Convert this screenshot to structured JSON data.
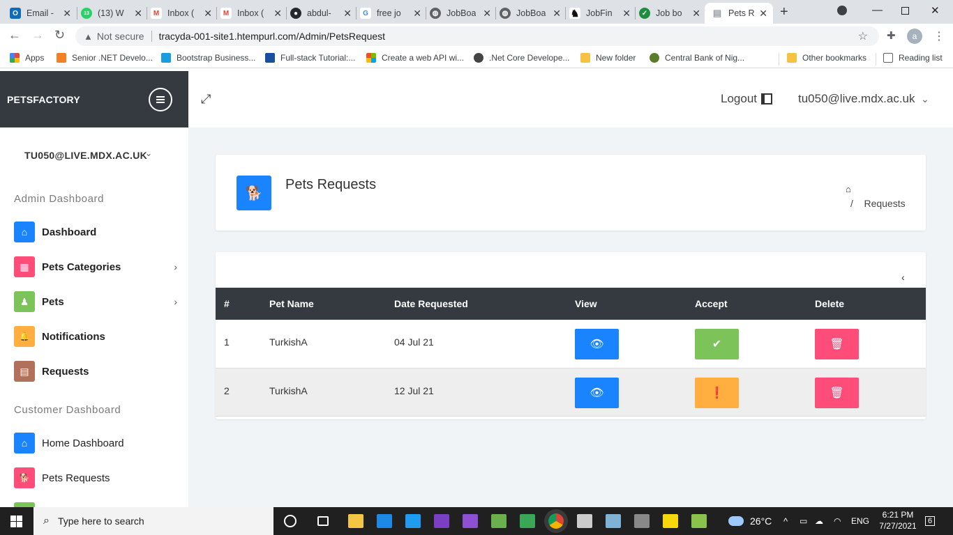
{
  "browser": {
    "tabs": [
      {
        "label": "Email -",
        "color": "#0f6cbd",
        "glyph": "O"
      },
      {
        "label": "(13) W",
        "color": "#25d366",
        "glyph": "13"
      },
      {
        "label": "Inbox (",
        "color": "#ea4335",
        "glyph": "M"
      },
      {
        "label": "Inbox (",
        "color": "#ea4335",
        "glyph": "M"
      },
      {
        "label": "abdul-",
        "color": "#24292e",
        "glyph": "●"
      },
      {
        "label": "free jo",
        "color": "#4285f4",
        "glyph": "G"
      },
      {
        "label": "JobBoa",
        "color": "#5f6368",
        "glyph": "◍"
      },
      {
        "label": "JobBoa",
        "color": "#5f6368",
        "glyph": "◍"
      },
      {
        "label": "JobFin",
        "color": "#111111",
        "glyph": "♞"
      },
      {
        "label": "Job bo",
        "color": "#1e8e3e",
        "glyph": "✓"
      },
      {
        "label": "Pets R",
        "color": "#9aa0a6",
        "glyph": "▤"
      }
    ],
    "close_glyph": "✕",
    "new_tab_glyph": "+",
    "not_secure_label": "Not secure",
    "url": "tracyda-001-site1.htempurl.com/Admin/PetsRequest",
    "profile_initial": "a",
    "bookmarks": [
      {
        "label": "Apps",
        "color": "#e8453c"
      },
      {
        "label": "Senior .NET Develo...",
        "color": "#f48024"
      },
      {
        "label": "Bootstrap Business...",
        "color": "#1b9be0"
      },
      {
        "label": "Full-stack Tutorial:...",
        "color": "#1a4fa0"
      },
      {
        "label": "Create a web API wi...",
        "color": "#f25022"
      },
      {
        "label": ".Net Core Develope...",
        "color": "#444444"
      },
      {
        "label": "New folder",
        "color": "#f6c244"
      },
      {
        "label": "Central Bank of Nig...",
        "color": "#5a7d2c"
      },
      {
        "label": "Other bookmarks",
        "color": "#f6c244"
      },
      {
        "label": "Reading list",
        "color": "#5f6368"
      }
    ]
  },
  "app": {
    "brand": "PETSFACTORY",
    "logout_label": "Logout",
    "user_email": "tu050@live.mdx.ac.uk",
    "sidebar_user": "TU050@LIVE.MDX.AC.UK",
    "admin_heading": "Admin Dashboard",
    "customer_heading": "Customer Dashboard",
    "admin_items": [
      {
        "label": "Dashboard",
        "color": "#1a84ff",
        "glyph": "⌂"
      },
      {
        "label": "Pets Categories",
        "color": "#ff4d7a",
        "glyph": "▦"
      },
      {
        "label": "Pets",
        "color": "#7cc35a",
        "glyph": "♟"
      },
      {
        "label": "Notifications",
        "color": "#ffae3f",
        "glyph": "🔔"
      },
      {
        "label": "Requests",
        "color": "#b0705a",
        "glyph": "▤"
      }
    ],
    "customer_items": [
      {
        "label": "Home Dashboard",
        "color": "#1a84ff",
        "glyph": "⌂"
      },
      {
        "label": "Pets Requests",
        "color": "#ff4d7a",
        "glyph": "🐕"
      }
    ],
    "page_title": "Pets Requests",
    "breadcrumb_sep": "/",
    "breadcrumb_current": "Requests",
    "table": {
      "headers": [
        "#",
        "Pet Name",
        "Date Requested",
        "View",
        "Accept",
        "Delete"
      ],
      "rows": [
        {
          "num": "1",
          "pet": "TurkishA",
          "date": "04 Jul 21",
          "accept_state": "accepted"
        },
        {
          "num": "2",
          "pet": "TurkishA",
          "date": "12 Jul 21",
          "accept_state": "pending"
        }
      ]
    }
  },
  "taskbar": {
    "search_placeholder": "Type here to search",
    "temperature": "26°C",
    "language": "ENG",
    "time": "6:21 PM",
    "date": "7/27/2021",
    "notification_count": "6"
  }
}
